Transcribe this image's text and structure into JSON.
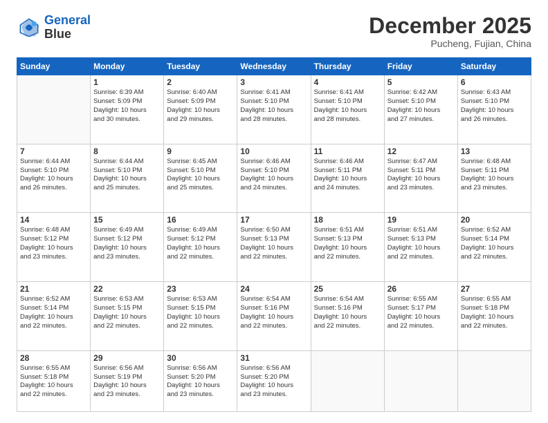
{
  "logo": {
    "line1": "General",
    "line2": "Blue"
  },
  "header": {
    "month_year": "December 2025",
    "location": "Pucheng, Fujian, China"
  },
  "days_of_week": [
    "Sunday",
    "Monday",
    "Tuesday",
    "Wednesday",
    "Thursday",
    "Friday",
    "Saturday"
  ],
  "weeks": [
    [
      {
        "day": "",
        "text": ""
      },
      {
        "day": "1",
        "text": "Sunrise: 6:39 AM\nSunset: 5:09 PM\nDaylight: 10 hours\nand 30 minutes."
      },
      {
        "day": "2",
        "text": "Sunrise: 6:40 AM\nSunset: 5:09 PM\nDaylight: 10 hours\nand 29 minutes."
      },
      {
        "day": "3",
        "text": "Sunrise: 6:41 AM\nSunset: 5:10 PM\nDaylight: 10 hours\nand 28 minutes."
      },
      {
        "day": "4",
        "text": "Sunrise: 6:41 AM\nSunset: 5:10 PM\nDaylight: 10 hours\nand 28 minutes."
      },
      {
        "day": "5",
        "text": "Sunrise: 6:42 AM\nSunset: 5:10 PM\nDaylight: 10 hours\nand 27 minutes."
      },
      {
        "day": "6",
        "text": "Sunrise: 6:43 AM\nSunset: 5:10 PM\nDaylight: 10 hours\nand 26 minutes."
      }
    ],
    [
      {
        "day": "7",
        "text": "Sunrise: 6:44 AM\nSunset: 5:10 PM\nDaylight: 10 hours\nand 26 minutes."
      },
      {
        "day": "8",
        "text": "Sunrise: 6:44 AM\nSunset: 5:10 PM\nDaylight: 10 hours\nand 25 minutes."
      },
      {
        "day": "9",
        "text": "Sunrise: 6:45 AM\nSunset: 5:10 PM\nDaylight: 10 hours\nand 25 minutes."
      },
      {
        "day": "10",
        "text": "Sunrise: 6:46 AM\nSunset: 5:10 PM\nDaylight: 10 hours\nand 24 minutes."
      },
      {
        "day": "11",
        "text": "Sunrise: 6:46 AM\nSunset: 5:11 PM\nDaylight: 10 hours\nand 24 minutes."
      },
      {
        "day": "12",
        "text": "Sunrise: 6:47 AM\nSunset: 5:11 PM\nDaylight: 10 hours\nand 23 minutes."
      },
      {
        "day": "13",
        "text": "Sunrise: 6:48 AM\nSunset: 5:11 PM\nDaylight: 10 hours\nand 23 minutes."
      }
    ],
    [
      {
        "day": "14",
        "text": "Sunrise: 6:48 AM\nSunset: 5:12 PM\nDaylight: 10 hours\nand 23 minutes."
      },
      {
        "day": "15",
        "text": "Sunrise: 6:49 AM\nSunset: 5:12 PM\nDaylight: 10 hours\nand 23 minutes."
      },
      {
        "day": "16",
        "text": "Sunrise: 6:49 AM\nSunset: 5:12 PM\nDaylight: 10 hours\nand 22 minutes."
      },
      {
        "day": "17",
        "text": "Sunrise: 6:50 AM\nSunset: 5:13 PM\nDaylight: 10 hours\nand 22 minutes."
      },
      {
        "day": "18",
        "text": "Sunrise: 6:51 AM\nSunset: 5:13 PM\nDaylight: 10 hours\nand 22 minutes."
      },
      {
        "day": "19",
        "text": "Sunrise: 6:51 AM\nSunset: 5:13 PM\nDaylight: 10 hours\nand 22 minutes."
      },
      {
        "day": "20",
        "text": "Sunrise: 6:52 AM\nSunset: 5:14 PM\nDaylight: 10 hours\nand 22 minutes."
      }
    ],
    [
      {
        "day": "21",
        "text": "Sunrise: 6:52 AM\nSunset: 5:14 PM\nDaylight: 10 hours\nand 22 minutes."
      },
      {
        "day": "22",
        "text": "Sunrise: 6:53 AM\nSunset: 5:15 PM\nDaylight: 10 hours\nand 22 minutes."
      },
      {
        "day": "23",
        "text": "Sunrise: 6:53 AM\nSunset: 5:15 PM\nDaylight: 10 hours\nand 22 minutes."
      },
      {
        "day": "24",
        "text": "Sunrise: 6:54 AM\nSunset: 5:16 PM\nDaylight: 10 hours\nand 22 minutes."
      },
      {
        "day": "25",
        "text": "Sunrise: 6:54 AM\nSunset: 5:16 PM\nDaylight: 10 hours\nand 22 minutes."
      },
      {
        "day": "26",
        "text": "Sunrise: 6:55 AM\nSunset: 5:17 PM\nDaylight: 10 hours\nand 22 minutes."
      },
      {
        "day": "27",
        "text": "Sunrise: 6:55 AM\nSunset: 5:18 PM\nDaylight: 10 hours\nand 22 minutes."
      }
    ],
    [
      {
        "day": "28",
        "text": "Sunrise: 6:55 AM\nSunset: 5:18 PM\nDaylight: 10 hours\nand 22 minutes."
      },
      {
        "day": "29",
        "text": "Sunrise: 6:56 AM\nSunset: 5:19 PM\nDaylight: 10 hours\nand 23 minutes."
      },
      {
        "day": "30",
        "text": "Sunrise: 6:56 AM\nSunset: 5:20 PM\nDaylight: 10 hours\nand 23 minutes."
      },
      {
        "day": "31",
        "text": "Sunrise: 6:56 AM\nSunset: 5:20 PM\nDaylight: 10 hours\nand 23 minutes."
      },
      {
        "day": "",
        "text": ""
      },
      {
        "day": "",
        "text": ""
      },
      {
        "day": "",
        "text": ""
      }
    ]
  ]
}
